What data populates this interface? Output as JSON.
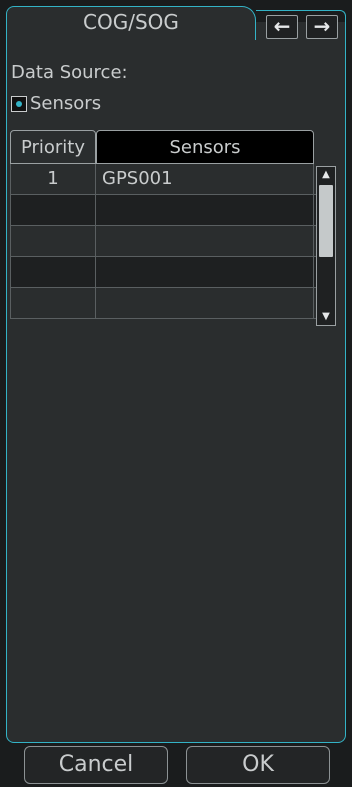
{
  "tab": {
    "title": "COG/SOG"
  },
  "nav": {
    "back_icon": "arrow-left-icon",
    "forward_icon": "arrow-right-icon",
    "back_glyph": "←",
    "forward_glyph": "→"
  },
  "data_source": {
    "label": "Data Source:",
    "option": "Sensors",
    "selected": true
  },
  "table": {
    "headers": {
      "priority": "Priority",
      "sensors": "Sensors"
    },
    "rows": [
      {
        "priority": "1",
        "sensor": "GPS001"
      },
      {
        "priority": "",
        "sensor": ""
      },
      {
        "priority": "",
        "sensor": ""
      },
      {
        "priority": "",
        "sensor": ""
      },
      {
        "priority": "",
        "sensor": ""
      }
    ]
  },
  "scrollbar": {
    "up_glyph": "▲",
    "down_glyph": "▼"
  },
  "footer": {
    "cancel_label": "Cancel",
    "ok_label": "OK"
  },
  "colors": {
    "accent": "#33b3c6",
    "panel": "#2a2d2e",
    "background": "#1a1c1d"
  }
}
